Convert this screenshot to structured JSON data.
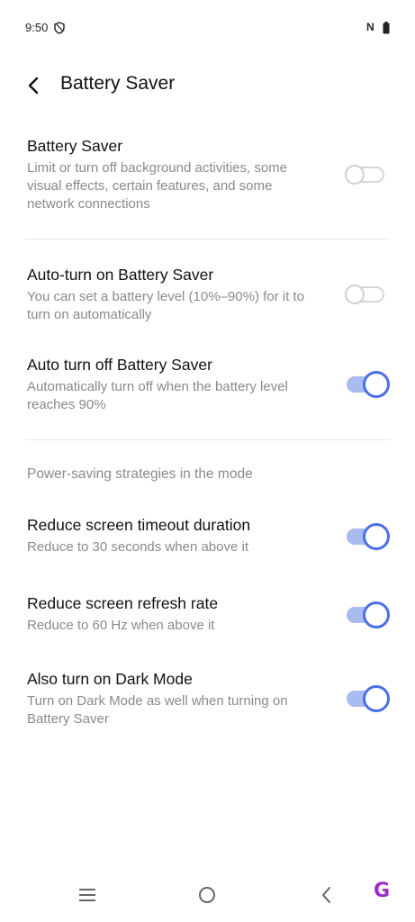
{
  "status_bar": {
    "time": "9:50",
    "nfc": "N"
  },
  "header": {
    "title": "Battery Saver"
  },
  "settings": [
    {
      "title": "Battery Saver",
      "description": "Limit or turn off background activities, some visual effects, certain features, and some network connections",
      "enabled": false
    },
    {
      "title": "Auto-turn on Battery Saver",
      "description": "You can set a battery level (10%–90%) for it to turn on automatically",
      "enabled": false
    },
    {
      "title": "Auto turn off Battery Saver",
      "description": "Automatically turn off when the battery level reaches 90%",
      "enabled": true
    }
  ],
  "section": {
    "label": "Power-saving strategies in the mode"
  },
  "strategies": [
    {
      "title": "Reduce screen timeout duration",
      "description": "Reduce to 30 seconds when above it",
      "enabled": true
    },
    {
      "title": "Reduce screen refresh rate",
      "description": "Reduce to 60 Hz when above it",
      "enabled": true
    },
    {
      "title": "Also turn on Dark Mode",
      "description": "Turn on Dark Mode as well when turning on Battery Saver",
      "enabled": true
    }
  ],
  "colors": {
    "accent": "#4a6fe3",
    "accent_track": "#a9bbf0",
    "secondary_text": "#8a8a8a"
  },
  "nav_bar": {
    "icons": [
      "menu-icon",
      "home-icon",
      "back-icon"
    ]
  },
  "watermark": "G"
}
